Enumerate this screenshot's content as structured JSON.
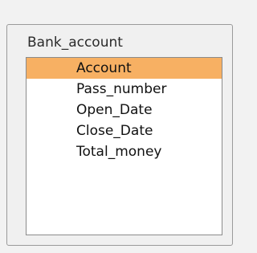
{
  "table": {
    "title": "Bank_account",
    "fields": [
      {
        "label": "Account",
        "selected": true
      },
      {
        "label": "Pass_number",
        "selected": false
      },
      {
        "label": "Open_Date",
        "selected": false
      },
      {
        "label": "Close_Date",
        "selected": false
      },
      {
        "label": "Total_money",
        "selected": false
      }
    ]
  },
  "colors": {
    "selected_row": "#f7b063",
    "panel_background": "#f0f0f0",
    "list_background": "#ffffff",
    "border": "#8b8b8b"
  }
}
